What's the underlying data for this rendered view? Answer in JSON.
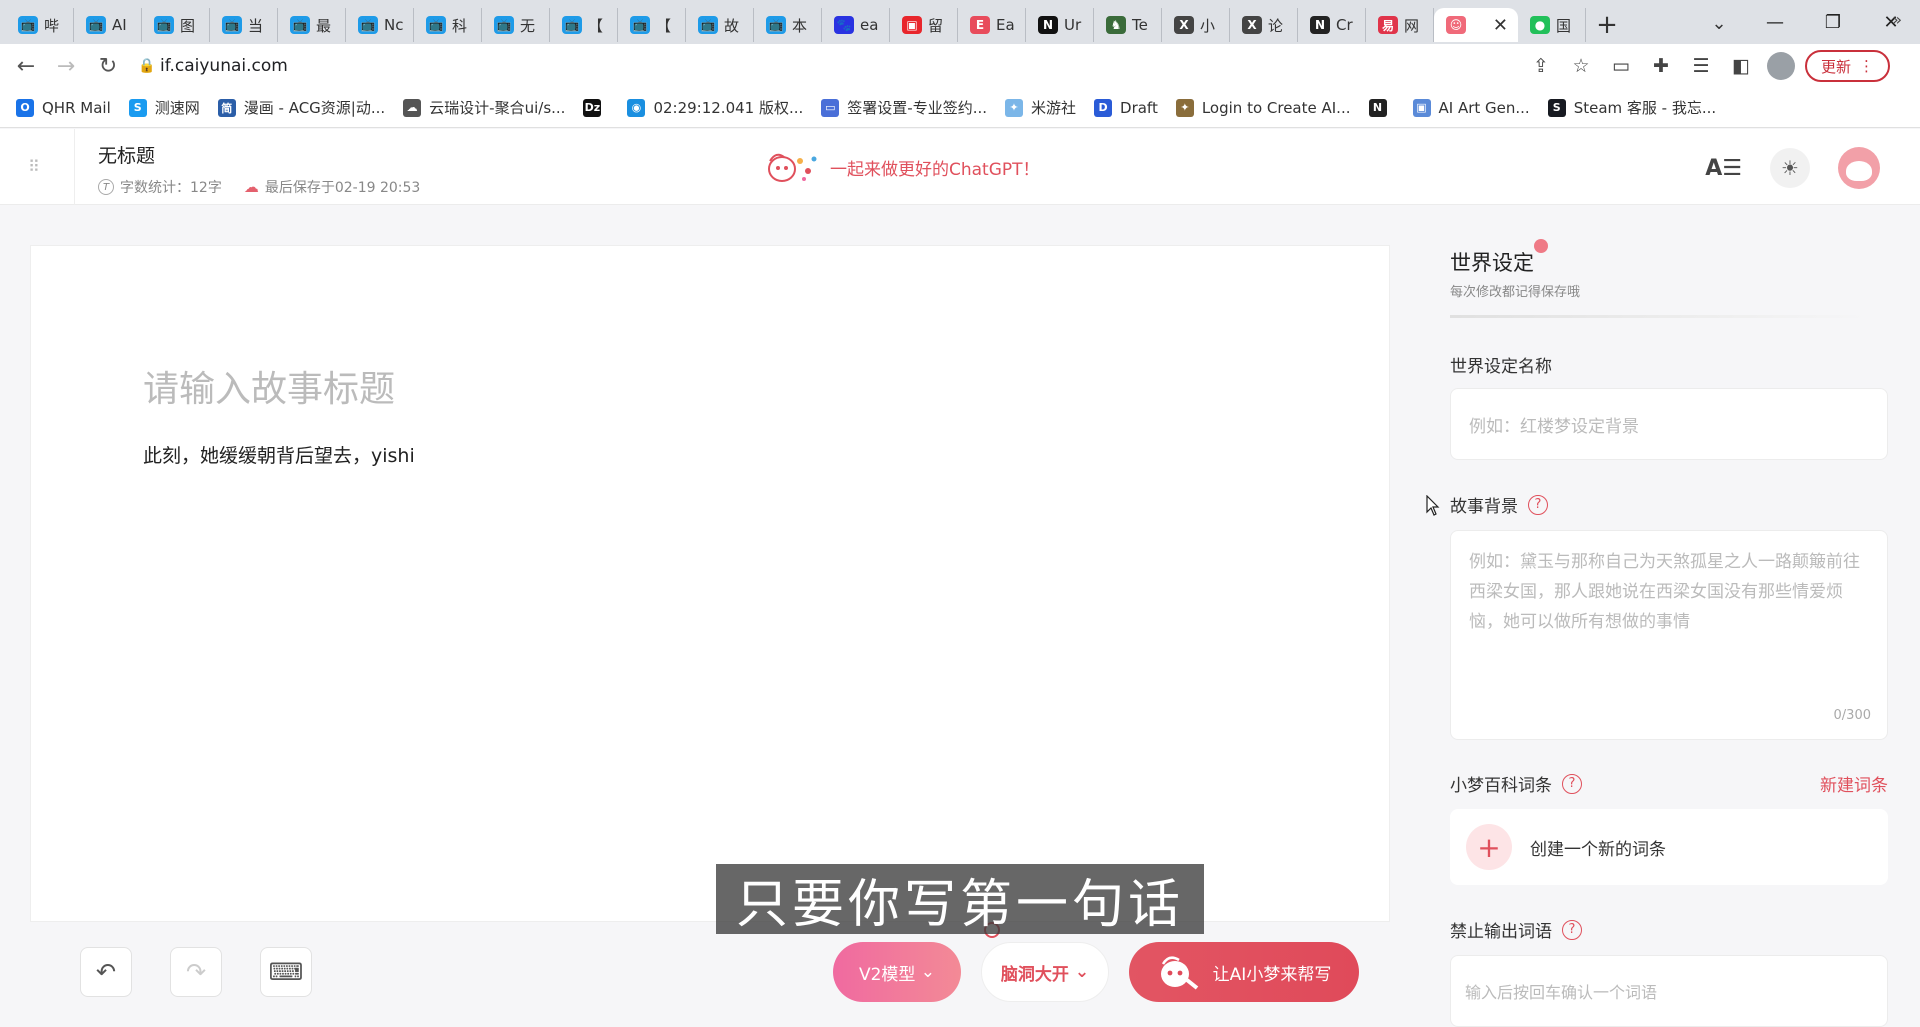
{
  "browser": {
    "tabs": [
      {
        "label": "哔",
        "fav_color": "#1e9be8",
        "fav_glyph": "📺"
      },
      {
        "label": "AI",
        "fav_color": "#1e9be8",
        "fav_glyph": "📺"
      },
      {
        "label": "图",
        "fav_color": "#1e9be8",
        "fav_glyph": "📺"
      },
      {
        "label": "当",
        "fav_color": "#1e9be8",
        "fav_glyph": "📺"
      },
      {
        "label": "最",
        "fav_color": "#1e9be8",
        "fav_glyph": "📺"
      },
      {
        "label": "Nc",
        "fav_color": "#1e9be8",
        "fav_glyph": "📺"
      },
      {
        "label": "科",
        "fav_color": "#1e9be8",
        "fav_glyph": "📺"
      },
      {
        "label": "无",
        "fav_color": "#1e9be8",
        "fav_glyph": "📺"
      },
      {
        "label": "【",
        "fav_color": "#1e9be8",
        "fav_glyph": "📺"
      },
      {
        "label": "【",
        "fav_color": "#1e9be8",
        "fav_glyph": "📺"
      },
      {
        "label": "故",
        "fav_color": "#1e9be8",
        "fav_glyph": "📺"
      },
      {
        "label": "本",
        "fav_color": "#1e9be8",
        "fav_glyph": "📺"
      },
      {
        "label": "ea",
        "fav_color": "#2932e1",
        "fav_glyph": "🐾"
      },
      {
        "label": "留",
        "fav_color": "#e8262c",
        "fav_glyph": "▣"
      },
      {
        "label": "Ea",
        "fav_color": "#e84c5c",
        "fav_glyph": "E"
      },
      {
        "label": "Ur",
        "fav_color": "#111111",
        "fav_glyph": "N"
      },
      {
        "label": "Te",
        "fav_color": "#3a6b3a",
        "fav_glyph": "♞"
      },
      {
        "label": "小",
        "fav_color": "#444444",
        "fav_glyph": "X"
      },
      {
        "label": "论",
        "fav_color": "#444444",
        "fav_glyph": "X"
      },
      {
        "label": "Cr",
        "fav_color": "#222222",
        "fav_glyph": "N"
      },
      {
        "label": "网",
        "fav_color": "#e0344a",
        "fav_glyph": "易"
      },
      {
        "label": "",
        "fav_color": "#f06a7a",
        "fav_glyph": "☺",
        "active": true
      },
      {
        "label": "国",
        "fav_color": "#22c05a",
        "fav_glyph": "●"
      }
    ],
    "url": "if.caiyunai.com",
    "update_label": "更新",
    "bookmarks": [
      {
        "label": "QHR Mail",
        "color": "#1a73e8",
        "glyph": "O"
      },
      {
        "label": "测速网",
        "color": "#1a9bf0",
        "glyph": "S"
      },
      {
        "label": "漫画 - ACG资源|动...",
        "color": "#2b5ea8",
        "glyph": "简"
      },
      {
        "label": "云瑞设计-聚合ui/s...",
        "color": "#555555",
        "glyph": "☁"
      },
      {
        "label": "",
        "color": "#111111",
        "glyph": "Dz"
      },
      {
        "label": "02:29:12.041 版权...",
        "color": "#1a8fe0",
        "glyph": "◉"
      },
      {
        "label": "签署设置-专业签约...",
        "color": "#4a6fd8",
        "glyph": "▭"
      },
      {
        "label": "米游社",
        "color": "#7bb6e8",
        "glyph": "✦"
      },
      {
        "label": "Draft",
        "color": "#2a5bd7",
        "glyph": "D"
      },
      {
        "label": "Login to Create AI...",
        "color": "#8a6d3b",
        "glyph": "✦"
      },
      {
        "label": "",
        "color": "#222222",
        "glyph": "N"
      },
      {
        "label": "AI Art Gen...",
        "color": "#5a8ad8",
        "glyph": "▣"
      },
      {
        "label": "Steam 客服 - 我忘...",
        "color": "#171a21",
        "glyph": "S"
      }
    ]
  },
  "header": {
    "doc_title": "无标题",
    "word_count": "字数统计：12字",
    "last_saved": "最后保存于02-19 20:53",
    "promo_text": "一起来做更好的ChatGPT！"
  },
  "editor": {
    "title_placeholder": "请输入故事标题",
    "body_text": "此刻，她缓缓朝背后望去，yishi",
    "model_label": "V2模型",
    "mode_label": "脑洞大开",
    "ai_help_label": "让AI小梦来帮写"
  },
  "subtitle": "只要你写第一句话",
  "panel": {
    "title": "世界设定",
    "subtitle": "每次修改都记得保存哦",
    "name_label": "世界设定名称",
    "name_placeholder": "例如：红楼梦设定背景",
    "background_label": "故事背景",
    "background_placeholder": "例如：黛玉与那称自己为天煞孤星之人一路颠簸前往西梁女国，那人跟她说在西梁女国没有那些情爱烦恼，她可以做所有想做的事情",
    "counter": "0/300",
    "wiki_label": "小梦百科词条",
    "new_entry_link": "新建词条",
    "create_entry_label": "创建一个新的词条",
    "banned_label": "禁止输出词语",
    "banned_placeholder": "输入后按回车确认一个词语"
  }
}
